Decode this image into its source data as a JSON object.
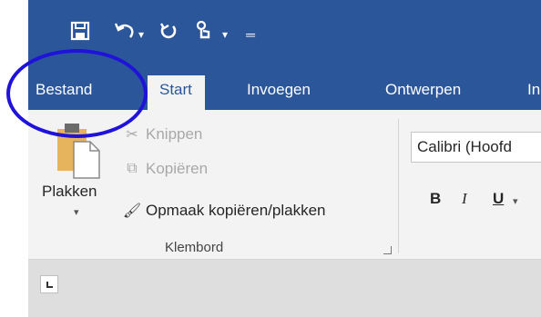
{
  "qat": {
    "save_icon": "save-icon",
    "undo_icon": "undo-icon",
    "redo_icon": "redo-icon",
    "touch_icon": "touch-mode-icon",
    "customize_icon": "customize-qat-icon"
  },
  "tabs": [
    {
      "label": "Bestand"
    },
    {
      "label": "Start"
    },
    {
      "label": "Invoegen"
    },
    {
      "label": "Ontwerpen"
    },
    {
      "label": "In"
    }
  ],
  "clipboard": {
    "paste_label": "Plakken",
    "cut_label": "Knippen",
    "copy_label": "Kopiëren",
    "format_painter_label": "Opmaak kopiëren/plakken",
    "group_label": "Klembord"
  },
  "font": {
    "name": "Calibri (Hoofd",
    "bold_label": "B",
    "italic_label": "I",
    "underline_label": "U"
  },
  "colors": {
    "title_blue": "#2b579a",
    "annotation_circle": "#1f12d9"
  }
}
